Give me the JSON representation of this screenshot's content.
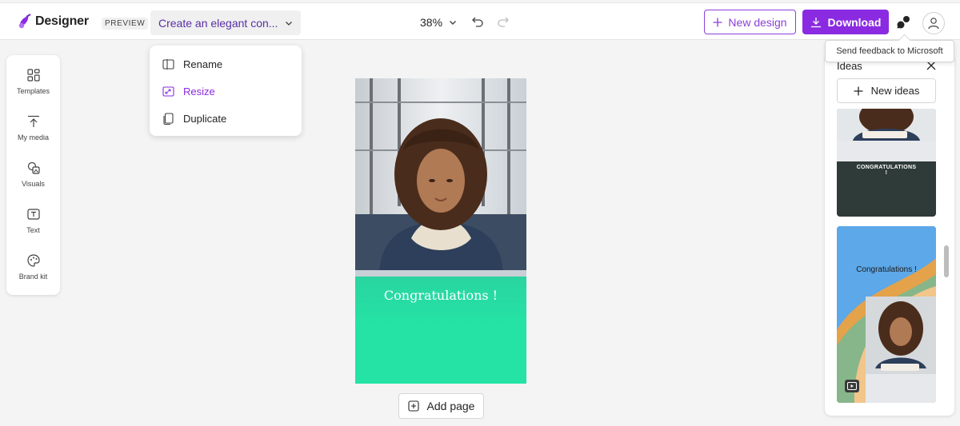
{
  "app": {
    "name": "Designer",
    "badge": "PREVIEW",
    "design_title": "Create an elegant con...",
    "zoom": "38%"
  },
  "header_actions": {
    "new_design": "New design",
    "download": "Download",
    "feedback_tooltip": "Send feedback to Microsoft"
  },
  "sidebar": {
    "items": [
      {
        "label": "Templates",
        "icon": "templates-icon"
      },
      {
        "label": "My media",
        "icon": "upload-icon"
      },
      {
        "label": "Visuals",
        "icon": "visuals-icon"
      },
      {
        "label": "Text",
        "icon": "text-icon"
      },
      {
        "label": "Brand kit",
        "icon": "palette-icon"
      }
    ]
  },
  "title_menu": {
    "items": [
      {
        "label": "Rename",
        "icon": "rename-icon"
      },
      {
        "label": "Resize",
        "icon": "resize-icon",
        "active": true
      },
      {
        "label": "Duplicate",
        "icon": "duplicate-icon"
      }
    ]
  },
  "canvas": {
    "headline": "Congratulations !",
    "add_page": "Add page"
  },
  "ideas_panel": {
    "title": "Ideas",
    "new_ideas": "New ideas",
    "cards": [
      {
        "text": "CONGRATULATIONS\n!"
      },
      {
        "text": "Congratulations !"
      }
    ]
  },
  "colors": {
    "accent": "#8a2be2",
    "canvas_green": "#25e3a4",
    "card1_dark": "#2f3b38",
    "card2_blue": "#5da8e8"
  }
}
